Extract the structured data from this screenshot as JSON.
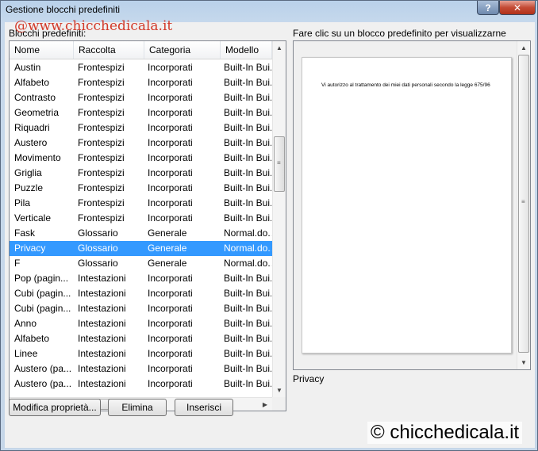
{
  "window": {
    "title": "Gestione blocchi predefiniti",
    "help_label": "?",
    "close_icon": "close-icon"
  },
  "watermarks": {
    "top": "@www.chicchedicala.it",
    "bottom": "© chicchedicala.it"
  },
  "list": {
    "label": "Blocchi predefiniti:",
    "columns": [
      "Nome",
      "Raccolta",
      "Categoria",
      "Modello"
    ],
    "selected_index": 12,
    "rows": [
      [
        "Austin",
        "Frontespizi",
        "Incorporati",
        "Built-In Bui..."
      ],
      [
        "Alfabeto",
        "Frontespizi",
        "Incorporati",
        "Built-In Bui..."
      ],
      [
        "Contrasto",
        "Frontespizi",
        "Incorporati",
        "Built-In Bui..."
      ],
      [
        "Geometria",
        "Frontespizi",
        "Incorporati",
        "Built-In Bui..."
      ],
      [
        "Riquadri",
        "Frontespizi",
        "Incorporati",
        "Built-In Bui..."
      ],
      [
        "Austero",
        "Frontespizi",
        "Incorporati",
        "Built-In Bui..."
      ],
      [
        "Movimento",
        "Frontespizi",
        "Incorporati",
        "Built-In Bui..."
      ],
      [
        "Griglia",
        "Frontespizi",
        "Incorporati",
        "Built-In Bui..."
      ],
      [
        "Puzzle",
        "Frontespizi",
        "Incorporati",
        "Built-In Bui..."
      ],
      [
        "Pila",
        "Frontespizi",
        "Incorporati",
        "Built-In Bui..."
      ],
      [
        "Verticale",
        "Frontespizi",
        "Incorporati",
        "Built-In Bui..."
      ],
      [
        "Fask",
        "Glossario",
        "Generale",
        "Normal.do..."
      ],
      [
        "Privacy",
        "Glossario",
        "Generale",
        "Normal.do..."
      ],
      [
        "F",
        "Glossario",
        "Generale",
        "Normal.do..."
      ],
      [
        "Pop (pagin...",
        "Intestazioni",
        "Incorporati",
        "Built-In Bui..."
      ],
      [
        "Cubi (pagin...",
        "Intestazioni",
        "Incorporati",
        "Built-In Bui..."
      ],
      [
        "Cubi (pagin...",
        "Intestazioni",
        "Incorporati",
        "Built-In Bui..."
      ],
      [
        "Anno",
        "Intestazioni",
        "Incorporati",
        "Built-In Bui..."
      ],
      [
        "Alfabeto",
        "Intestazioni",
        "Incorporati",
        "Built-In Bui..."
      ],
      [
        "Linee",
        "Intestazioni",
        "Incorporati",
        "Built-In Bui..."
      ],
      [
        "Austero (pa...",
        "Intestazioni",
        "Incorporati",
        "Built-In Bui..."
      ],
      [
        "Austero (pa...",
        "Intestazioni",
        "Incorporati",
        "Built-In Bui..."
      ]
    ]
  },
  "preview": {
    "label": "Fare clic su un blocco predefinito per visualizzarne l'anteprima",
    "page_text": "Vi autorizzo al trattamento dei miei dati personali secondo la legge 675/96",
    "name": "Privacy"
  },
  "buttons": {
    "modify": "Modifica proprietà...",
    "delete": "Elimina",
    "insert": "Inserisci"
  },
  "colors": {
    "selection": "#3399ff",
    "watermark_top": "#d23a2a"
  }
}
